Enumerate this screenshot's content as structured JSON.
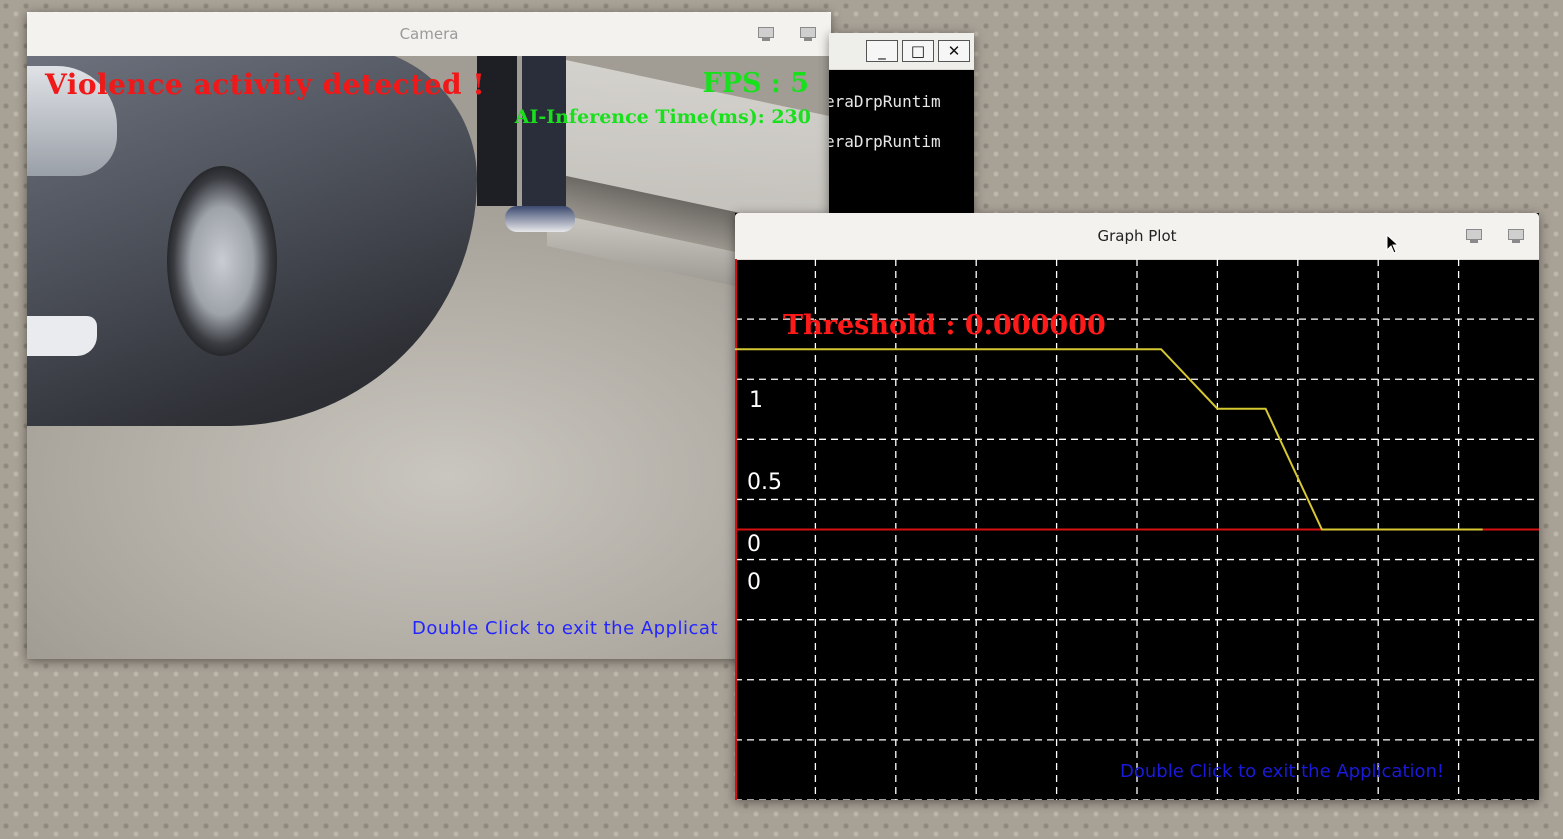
{
  "camera_window": {
    "title": "Camera",
    "alert_text": "Violence activity detected !",
    "fps_text": "FPS : 5",
    "inference_text": "AI-Inference Time(ms): 230",
    "exit_hint": "Double Click to exit the Applicat",
    "alert_color": "#f01818",
    "status_color": "#19e01c",
    "hint_color": "#2424ff"
  },
  "terminal_window": {
    "minimize_label": "_",
    "maximize_label": "□",
    "close_label": "✕",
    "lines": [
      "eraDrpRuntim",
      "eraDrpRuntim"
    ]
  },
  "graph_window": {
    "title": "Graph Plot",
    "threshold_text": "Threshold : 0.000000",
    "exit_hint": "Double Click to exit the Application!",
    "labels": {
      "one": "1",
      "half": "0.5",
      "zero_upper": "0",
      "zero_lower": "0"
    },
    "threshold_color": "#ff1a1a",
    "line_color": "#d6c832",
    "baseline_color": "#d61010",
    "grid_color": "#ffffff",
    "hint_color": "#1a1adc"
  },
  "chart_data": {
    "type": "line",
    "series": [
      {
        "values": [
          {
            "x": 0,
            "y": 1
          },
          {
            "x": 1,
            "y": 1
          },
          {
            "x": 2,
            "y": 1
          },
          {
            "x": 3,
            "y": 1
          },
          {
            "x": 4,
            "y": 1
          },
          {
            "x": 5,
            "y": 1
          },
          {
            "x": 5.3,
            "y": 1
          },
          {
            "x": 6,
            "y": 0.67
          },
          {
            "x": 6.6,
            "y": 0.67
          },
          {
            "x": 7.3,
            "y": 0
          },
          {
            "x": 8,
            "y": 0
          },
          {
            "x": 9,
            "y": 0
          },
          {
            "x": 9.3,
            "y": 0
          }
        ]
      }
    ],
    "threshold": 0.0,
    "ylim": [
      -1.5,
      1.5
    ],
    "xlim": [
      0,
      10
    ],
    "grid": true
  }
}
